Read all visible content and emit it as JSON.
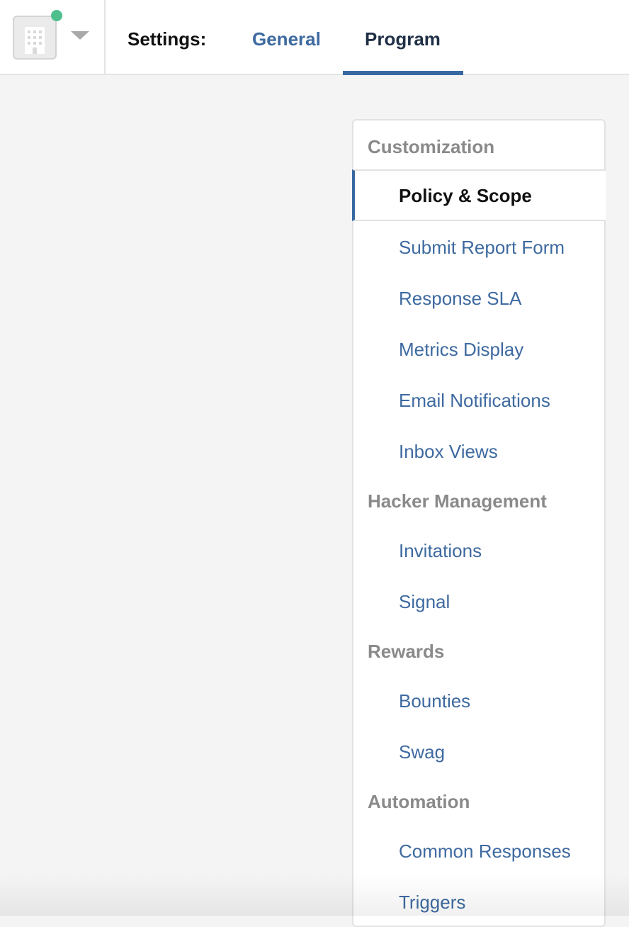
{
  "header": {
    "settings_label": "Settings:",
    "tabs": [
      {
        "label": "General",
        "active": false
      },
      {
        "label": "Program",
        "active": true
      }
    ]
  },
  "org_switcher": {
    "icon": "building-icon",
    "status": "online",
    "status_color": "#4fc08d"
  },
  "menu": {
    "sections": [
      {
        "title": "Customization",
        "items": [
          "Policy & Scope",
          "Submit Report Form",
          "Response SLA",
          "Metrics Display",
          "Email Notifications",
          "Inbox Views"
        ]
      },
      {
        "title": "Hacker Management",
        "items": [
          "Invitations",
          "Signal"
        ]
      },
      {
        "title": "Rewards",
        "items": [
          "Bounties",
          "Swag"
        ]
      },
      {
        "title": "Automation",
        "items": [
          "Common Responses",
          "Triggers"
        ]
      }
    ],
    "active_item": "Policy & Scope"
  },
  "colors": {
    "accent": "#3868a2",
    "link": "#3e6aa0",
    "section_title": "#8a8a8a",
    "background": "#f4f4f4"
  }
}
